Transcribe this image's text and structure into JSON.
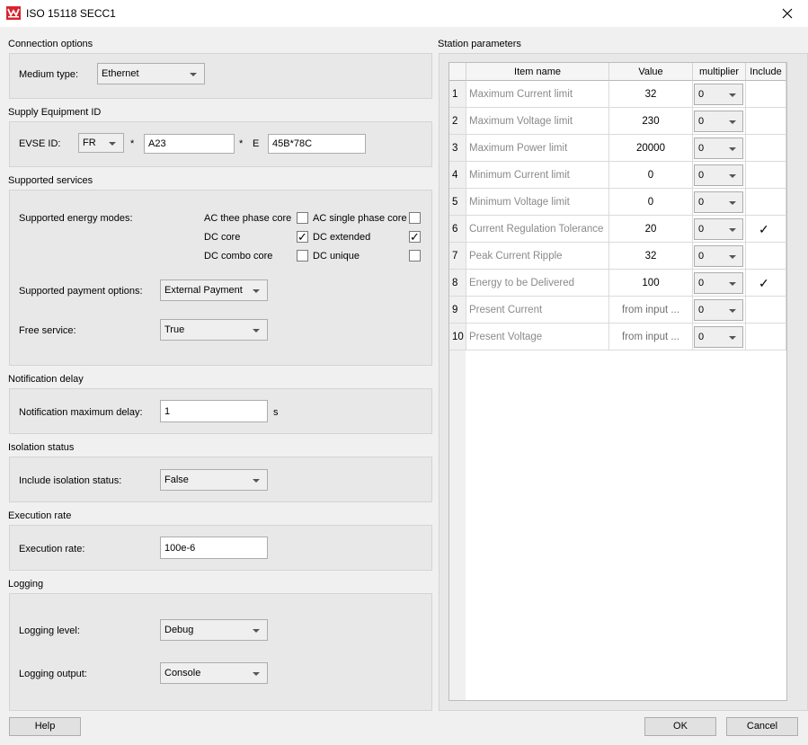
{
  "window": {
    "title": "ISO 15118 SECC1"
  },
  "connection": {
    "section_title": "Connection options",
    "medium_label": "Medium type:",
    "medium_value": "Ethernet"
  },
  "supply": {
    "section_title": "Supply Equipment ID",
    "evse_label": "EVSE ID:",
    "country": "FR",
    "sep1": "*",
    "operator": "A23",
    "sep2": "*",
    "e_label": "E",
    "id": "45B*78C"
  },
  "services": {
    "section_title": "Supported services",
    "energy_label": "Supported energy modes:",
    "modes": [
      {
        "label": "AC thee phase core",
        "checked": false
      },
      {
        "label": "AC single phase core",
        "checked": false
      },
      {
        "label": "DC core",
        "checked": true
      },
      {
        "label": "DC extended",
        "checked": true
      },
      {
        "label": "DC combo core",
        "checked": false
      },
      {
        "label": "DC unique",
        "checked": false
      }
    ],
    "payment_label": "Supported payment options:",
    "payment_value": "External Payment",
    "free_label": "Free service:",
    "free_value": "True"
  },
  "notification": {
    "section_title": "Notification delay",
    "label": "Notification maximum delay:",
    "value": "1",
    "unit": "s"
  },
  "isolation": {
    "section_title": "Isolation status",
    "label": "Include isolation status:",
    "value": "False"
  },
  "execution": {
    "section_title": "Execution rate",
    "label": "Execution rate:",
    "value": "100e-6"
  },
  "logging": {
    "section_title": "Logging",
    "level_label": "Logging level:",
    "level_value": "Debug",
    "output_label": "Logging output:",
    "output_value": "Console"
  },
  "station": {
    "section_title": "Station parameters",
    "headers": {
      "name": "Item name",
      "value": "Value",
      "multiplier": "multiplier",
      "include": "Include"
    },
    "rows": [
      {
        "num": "1",
        "name": "Maximum Current limit",
        "value": "32",
        "multiplier": "0",
        "include": false
      },
      {
        "num": "2",
        "name": "Maximum Voltage limit",
        "value": "230",
        "multiplier": "0",
        "include": false
      },
      {
        "num": "3",
        "name": "Maximum Power limit",
        "value": "20000",
        "multiplier": "0",
        "include": false
      },
      {
        "num": "4",
        "name": "Minimum Current limit",
        "value": "0",
        "multiplier": "0",
        "include": false
      },
      {
        "num": "5",
        "name": "Minimum Voltage limit",
        "value": "0",
        "multiplier": "0",
        "include": false
      },
      {
        "num": "6",
        "name": "Current Regulation Tolerance",
        "value": "20",
        "multiplier": "0",
        "include": true
      },
      {
        "num": "7",
        "name": "Peak Current Ripple",
        "value": "32",
        "multiplier": "0",
        "include": false
      },
      {
        "num": "8",
        "name": "Energy to be Delivered",
        "value": "100",
        "multiplier": "0",
        "include": true
      },
      {
        "num": "9",
        "name": "Present Current",
        "value": "from input ...",
        "multiplier": "0",
        "include": false
      },
      {
        "num": "10",
        "name": "Present Voltage",
        "value": "from input ...",
        "multiplier": "0",
        "include": false
      }
    ]
  },
  "buttons": {
    "help": "Help",
    "ok": "OK",
    "cancel": "Cancel"
  },
  "colors": {
    "logo": "#d9232d",
    "group_bg": "#e8e8e8",
    "window_bg": "#f0f0f0"
  }
}
